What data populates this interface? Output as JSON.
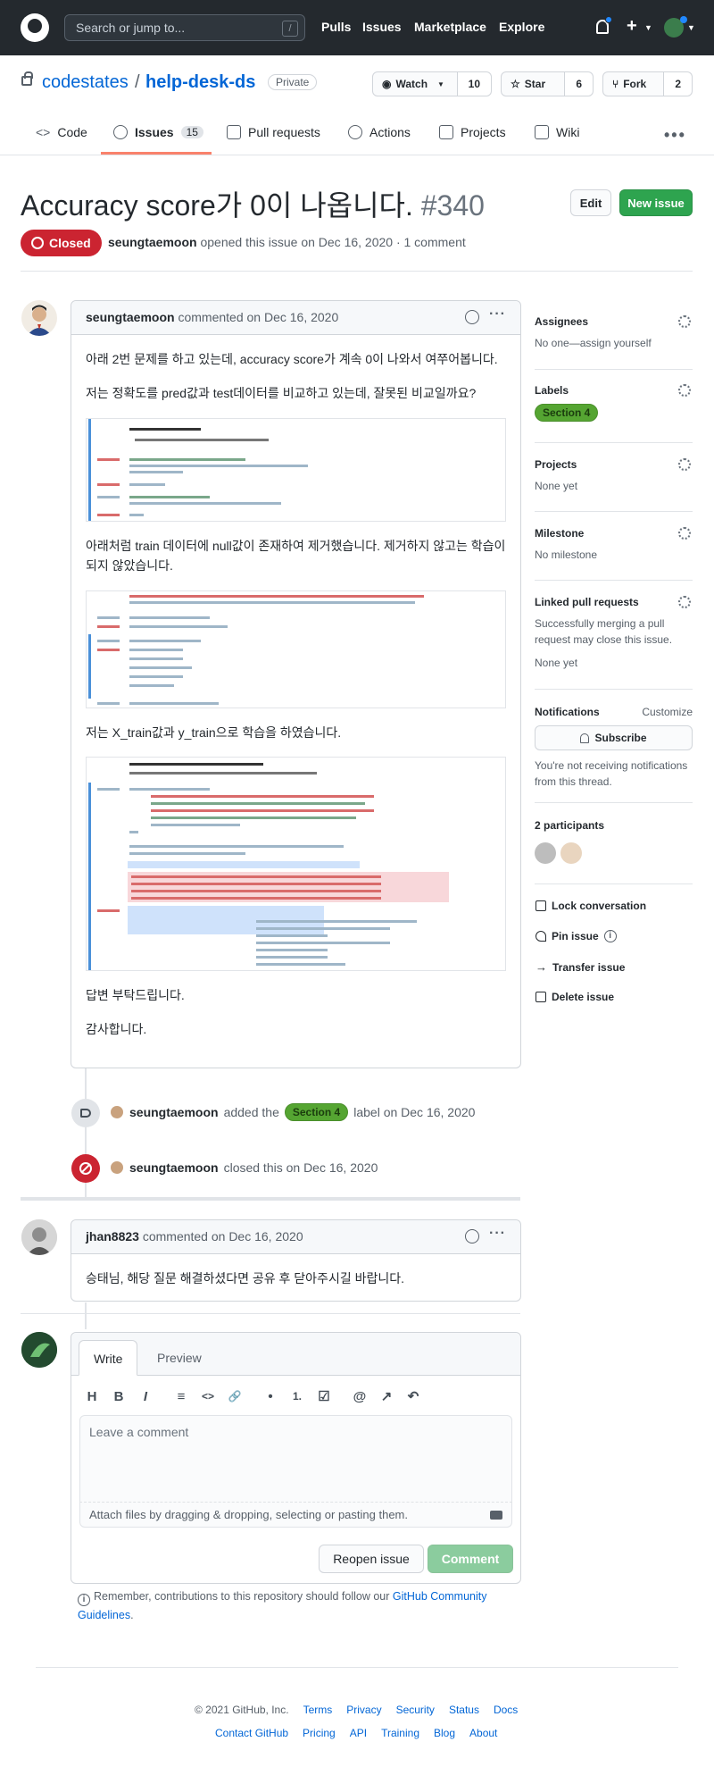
{
  "header": {
    "search_placeholder": "Search or jump to...",
    "slash": "/",
    "nav": [
      "Pulls",
      "Issues",
      "Marketplace",
      "Explore"
    ]
  },
  "repo": {
    "owner": "codestates",
    "separator": "/",
    "name": "help-desk-ds",
    "visibility": "Private",
    "watch_label": "Watch",
    "watch_count": "10",
    "star_label": "Star",
    "star_count": "6",
    "fork_label": "Fork",
    "fork_count": "2"
  },
  "tabs": [
    {
      "label": "Code"
    },
    {
      "label": "Issues",
      "count": "15"
    },
    {
      "label": "Pull requests"
    },
    {
      "label": "Actions"
    },
    {
      "label": "Projects"
    },
    {
      "label": "Wiki"
    }
  ],
  "issue": {
    "title": "Accuracy score가 0이 나옵니다.",
    "number": "#340",
    "edit_label": "Edit",
    "new_issue_label": "New issue",
    "state": "Closed",
    "author": "seungtaemoon",
    "meta_rest": "opened this issue on Dec 16, 2020 · 1 comment"
  },
  "comment1": {
    "author": "seungtaemoon",
    "action": "commented on Dec 16, 2020",
    "p1": "아래 2번 문제를 하고 있는데, accuracy score가 계속 0이 나와서 여쭈어봅니다.",
    "p2": "저는 정확도를 pred값과 test데이터를 비교하고 있는데, 잘못된 비교일까요?",
    "p3": "아래처럼 train 데이터에 null값이 존재하여 제거했습니다. 제거하지 않고는 학습이 되지 않았습니다.",
    "p4": "저는 X_train값과 y_train으로 학습을 하였습니다.",
    "p5": "답변 부탁드립니다.",
    "p6": "감사합니다."
  },
  "timeline": {
    "labeled_author": "seungtaemoon",
    "labeled_pre": "added the",
    "labeled_label": "Section 4",
    "labeled_post": "label on Dec 16, 2020",
    "closed_author": "seungtaemoon",
    "closed_text": "closed this on Dec 16, 2020"
  },
  "comment2": {
    "author": "jhan8823",
    "action": "commented on Dec 16, 2020",
    "body": "승태님, 해당 질문 해결하셨다면 공유 후 닫아주시길 바랍니다."
  },
  "editor": {
    "tab_write": "Write",
    "tab_preview": "Preview",
    "toolbar": [
      "H",
      "B",
      "I",
      "≡",
      "<>",
      "🔗",
      "•",
      "1.",
      "☑",
      "@",
      "↗",
      "↶"
    ],
    "placeholder": "Leave a comment",
    "attach": "Attach files by dragging & dropping, selecting or pasting them.",
    "reopen_label": "Reopen issue",
    "comment_label": "Comment",
    "remember_pre": "Remember, contributions to this repository should follow our",
    "remember_link": "GitHub Community Guidelines",
    "remember_post": "."
  },
  "sidebar": {
    "assignees_title": "Assignees",
    "assignees_value": "No one—assign yourself",
    "labels_title": "Labels",
    "label": "Section 4",
    "projects_title": "Projects",
    "projects_value": "None yet",
    "milestone_title": "Milestone",
    "milestone_value": "No milestone",
    "linked_title": "Linked pull requests",
    "linked_desc": "Successfully merging a pull request may close this issue.",
    "linked_value": "None yet",
    "notifications_title": "Notifications",
    "customize": "Customize",
    "subscribe": "Subscribe",
    "notif_desc": "You're not receiving notifications from this thread.",
    "participants_title": "2 participants",
    "lock": "Lock conversation",
    "pin": "Pin issue",
    "transfer": "Transfer issue",
    "delete": "Delete issue"
  },
  "footer": {
    "copyright": "© 2021 GitHub, Inc.",
    "row1": [
      "Terms",
      "Privacy",
      "Security",
      "Status",
      "Docs"
    ],
    "row2": [
      "Contact GitHub",
      "Pricing",
      "API",
      "Training",
      "Blog",
      "About"
    ]
  },
  "colors": {
    "header_bg": "#24292e",
    "link": "#0366d6",
    "closed_red": "#cb2431",
    "green": "#2ea44f",
    "label_green": "#55a532"
  }
}
